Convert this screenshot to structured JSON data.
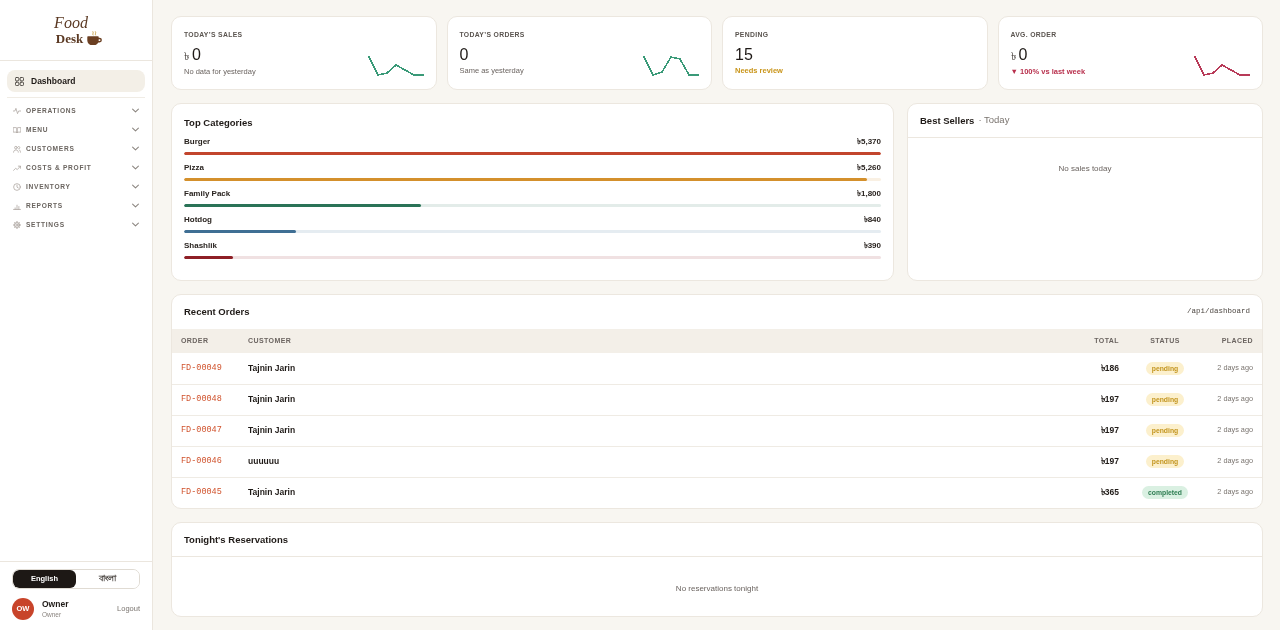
{
  "sidebar": {
    "logo": {
      "line_1": "Food",
      "line_2": "Desk"
    },
    "nav": [
      {
        "kind": "link",
        "label": "Dashboard",
        "selected": true
      },
      {
        "kind": "group",
        "label": "OPERATIONS",
        "selected": false,
        "expanded": false
      },
      {
        "kind": "group",
        "label": "MENU",
        "selected": false,
        "expanded": false
      },
      {
        "kind": "group",
        "label": "CUSTOMERS",
        "selected": false,
        "expanded": false
      },
      {
        "kind": "group",
        "label": "COSTS & PROFIT",
        "selected": false,
        "expanded": false
      },
      {
        "kind": "group",
        "label": "INVENTORY",
        "selected": false,
        "expanded": false
      },
      {
        "kind": "group",
        "label": "REPORTS",
        "selected": false,
        "expanded": false
      },
      {
        "kind": "group",
        "label": "SETTINGS",
        "selected": false,
        "expanded": false
      }
    ],
    "language": [
      {
        "label": "English",
        "selected": true
      },
      {
        "label": "বাংলা",
        "selected": false
      }
    ],
    "user": {
      "initials": "OW",
      "name": "Owner",
      "role": "Owner",
      "logout": "Logout"
    }
  },
  "stats": [
    {
      "kind": "muted",
      "label": "TODAY’S SALES",
      "currency": "৳",
      "value": "0",
      "note": "No data for yesterday",
      "sparkline": {
        "color": "#3a9a78"
      }
    },
    {
      "kind": "muted",
      "label": "TODAY’S ORDERS",
      "value": "0",
      "note": "Same as yesterday",
      "sparkline": {
        "color": "#3a9a78"
      }
    },
    {
      "kind": "warning",
      "label": "PENDING",
      "value": "15",
      "note": "Needs review"
    },
    {
      "kind": "danger",
      "label": "AVG. ORDER",
      "currency": "৳",
      "value": "0",
      "note": "▼ 100% vs last week",
      "sparkline": {
        "color": "#b83a58"
      }
    }
  ],
  "top_categories": {
    "title": "Top Categories",
    "items": [
      {
        "name": "Burger",
        "amount": "৳5,370",
        "level": 1,
        "color": "#c2452d"
      },
      {
        "name": "Pizza",
        "amount": "৳5,260",
        "level": 0.98,
        "color": "#d4902c"
      },
      {
        "name": "Family Pack",
        "amount": "৳1,800",
        "level": 0.34,
        "color": "#2a7357"
      },
      {
        "name": "Hotdog",
        "amount": "৳840",
        "level": 0.16,
        "color": "#3f6f94"
      },
      {
        "name": "Shashlik",
        "amount": "৳390",
        "level": 0.07,
        "color": "#8e1f26"
      }
    ]
  },
  "best_sellers": {
    "title": "Best Sellers",
    "subtitle": "· Today",
    "empty": "No sales today"
  },
  "recent_orders": {
    "title": "Recent Orders",
    "endpoint": "/api/dashboard",
    "columns": [
      "ORDER",
      "CUSTOMER",
      "TOTAL",
      "STATUS",
      "PLACED"
    ],
    "rows": [
      {
        "kind": "pending",
        "order": "FD-00049",
        "customer": "Tajnin Jarin",
        "total": "৳186",
        "status": "pending",
        "placed": "2 days ago"
      },
      {
        "kind": "pending",
        "order": "FD-00048",
        "customer": "Tajnin Jarin",
        "total": "৳197",
        "status": "pending",
        "placed": "2 days ago"
      },
      {
        "kind": "pending",
        "order": "FD-00047",
        "customer": "Tajnin Jarin",
        "total": "৳197",
        "status": "pending",
        "placed": "2 days ago"
      },
      {
        "kind": "pending",
        "order": "FD-00046",
        "customer": "uuuuuu",
        "total": "৳197",
        "status": "pending",
        "placed": "2 days ago"
      },
      {
        "kind": "completed",
        "order": "FD-00045",
        "customer": "Tajnin Jarin",
        "total": "৳365",
        "status": "completed",
        "placed": "2 days ago"
      }
    ]
  },
  "reservations": {
    "title": "Tonight's Reservations",
    "empty": "No reservations tonight"
  }
}
